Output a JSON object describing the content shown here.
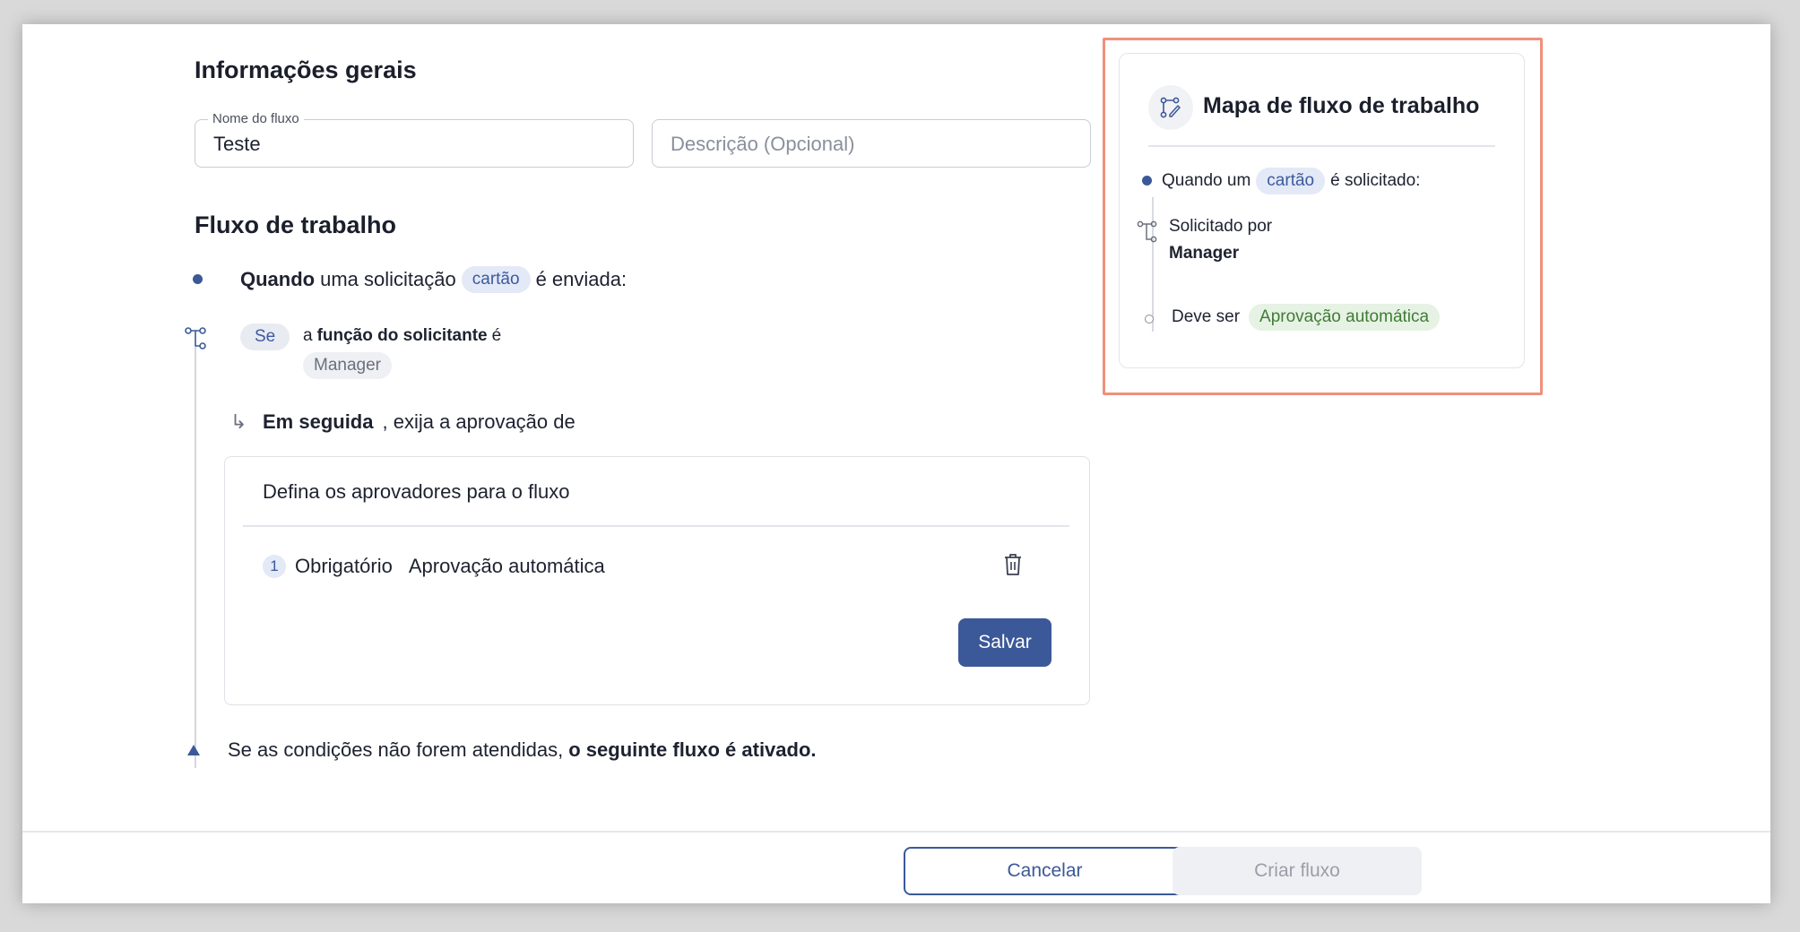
{
  "general": {
    "title": "Informações gerais",
    "name_field": {
      "label": "Nome do fluxo",
      "value": "Teste"
    },
    "description_field": {
      "placeholder": "Descrição (Opcional)"
    }
  },
  "workflow": {
    "title": "Fluxo de trabalho",
    "trigger": {
      "bold": "Quando",
      "text": "uma solicitação",
      "chip": "cartão",
      "suffix": "é enviada:"
    },
    "condition": {
      "chip": "Se",
      "prefix": "a",
      "bold": "função do solicitante",
      "suffix": "é",
      "value_chip": "Manager"
    },
    "then": {
      "bold": "Em seguida",
      "text": ", exija a aprovação de"
    },
    "approvers_card": {
      "title": "Defina os aprovadores para o fluxo",
      "rows": [
        {
          "index": "1",
          "requirement": "Obrigatório",
          "approver": "Aprovação automática"
        }
      ],
      "save_label": "Salvar"
    },
    "fallback": {
      "text": "Se as condições não forem atendidas,",
      "bold": "o seguinte fluxo é ativado."
    }
  },
  "map": {
    "title": "Mapa de fluxo de trabalho",
    "trigger": {
      "prefix": "Quando um",
      "chip": "cartão",
      "suffix": "é solicitado:"
    },
    "requested_by": {
      "label": "Solicitado por",
      "value": "Manager"
    },
    "must_be": {
      "label": "Deve ser",
      "chip": "Aprovação automática"
    }
  },
  "footer": {
    "cancel_label": "Cancelar",
    "create_label": "Criar fluxo"
  },
  "colors": {
    "primary": "#3b5998",
    "highlight_border": "#f0907a",
    "chip_blue_bg": "#e3e9f7",
    "chip_green_bg": "#e6f2e3"
  }
}
